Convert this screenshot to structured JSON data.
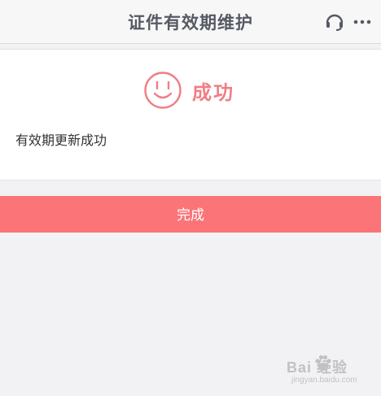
{
  "header": {
    "title": "证件有效期维护",
    "service_icon": "headset-icon",
    "more_icon": "more-icon"
  },
  "result": {
    "status_text": "成功",
    "status_icon": "smile-icon",
    "message": "有效期更新成功"
  },
  "actions": {
    "done_label": "完成"
  },
  "watermark": {
    "brand": "Bai  经验",
    "url": "jingyan.baidu.com"
  },
  "colors": {
    "accent": "#fb7478",
    "status_text": "#f07e84",
    "header_bg": "#f7f7f8",
    "page_bg": "#f2f2f4"
  }
}
